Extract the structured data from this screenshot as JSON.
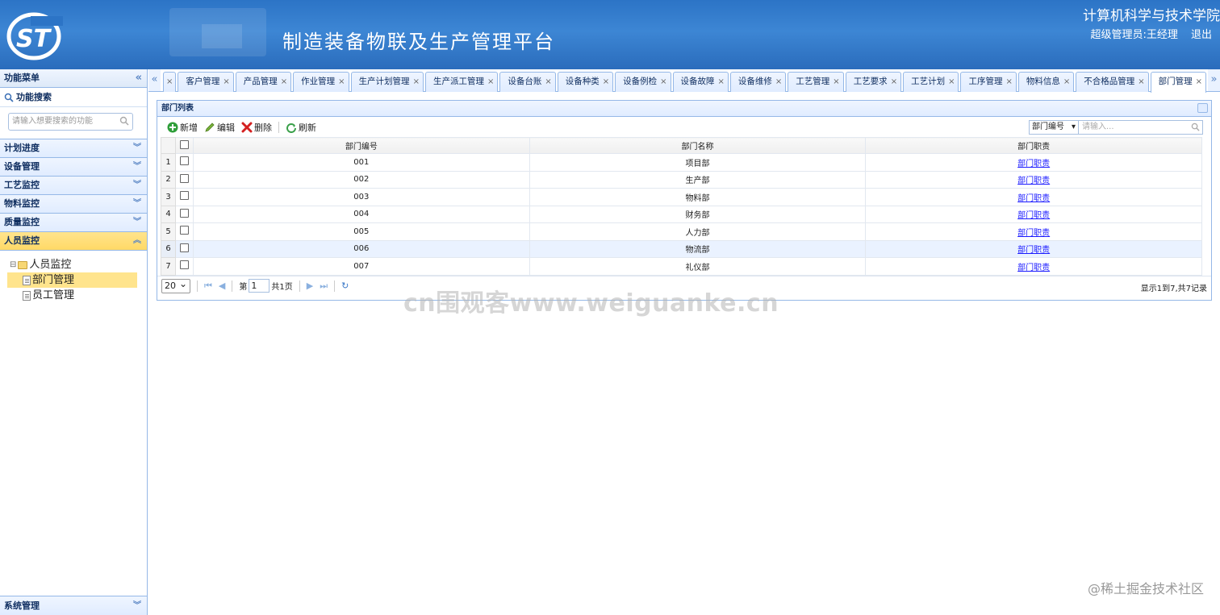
{
  "header": {
    "platform_title": "制造装备物联及生产管理平台",
    "college": "计算机科学与技术学院",
    "user_role": "超级管理员:",
    "user_name": "王经理",
    "logout": "退出"
  },
  "sidebar": {
    "title": "功能菜单",
    "search_title": "功能搜索",
    "search_placeholder": "请输入想要搜索的功能",
    "sections": [
      "计划进度",
      "设备管理",
      "工艺监控",
      "物料监控",
      "质量监控"
    ],
    "active_section": "人员监控",
    "tree_root": "人员监控",
    "tree_items": [
      "部门管理",
      "员工管理"
    ],
    "bottom_section": "系统管理"
  },
  "tabs": [
    "客户管理",
    "产品管理",
    "作业管理",
    "生产计划管理",
    "生产派工管理",
    "设备台账",
    "设备种类",
    "设备例检",
    "设备故障",
    "设备维修",
    "工艺管理",
    "工艺要求",
    "工艺计划",
    "工序管理",
    "物料信息",
    "不合格品管理",
    "部门管理"
  ],
  "panel": {
    "title": "部门列表",
    "toolbar": {
      "add": "新增",
      "edit": "编辑",
      "delete": "删除",
      "refresh": "刷新"
    },
    "search_field": "部门编号",
    "search_placeholder": "请输入...",
    "columns": [
      "部门编号",
      "部门名称",
      "部门职责"
    ],
    "rows": [
      {
        "n": "1",
        "code": "001",
        "name": "项目部",
        "duty": "部门职责"
      },
      {
        "n": "2",
        "code": "002",
        "name": "生产部",
        "duty": "部门职责"
      },
      {
        "n": "3",
        "code": "003",
        "name": "物料部",
        "duty": "部门职责"
      },
      {
        "n": "4",
        "code": "004",
        "name": "财务部",
        "duty": "部门职责"
      },
      {
        "n": "5",
        "code": "005",
        "name": "人力部",
        "duty": "部门职责"
      },
      {
        "n": "6",
        "code": "006",
        "name": "物流部",
        "duty": "部门职责"
      },
      {
        "n": "7",
        "code": "007",
        "name": "礼仪部",
        "duty": "部门职责"
      }
    ],
    "pager": {
      "page_size": "20",
      "page_prefix": "第",
      "page": "1",
      "page_suffix": "共1页",
      "info": "显示1到7,共7记录"
    }
  },
  "watermark": "cn围观客www.weiguanke.cn",
  "credit": "@稀土掘金技术社区"
}
